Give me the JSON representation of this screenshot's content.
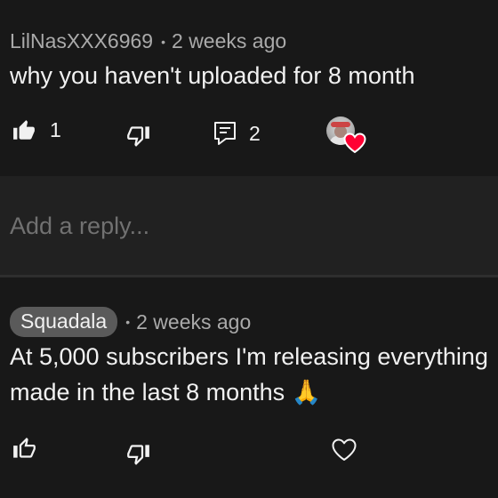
{
  "comment": {
    "author": "LilNasXXX6969",
    "separator": "•",
    "time": "2 weeks ago",
    "text": "why you haven't uploaded for 8 month",
    "like_count": "1",
    "reply_count": "2"
  },
  "reply_box": {
    "placeholder": "Add a reply..."
  },
  "reply": {
    "author": "Squadala",
    "separator": "•",
    "time": "2 weeks ago",
    "text_line1": "At 5,000 subscribers I'm releasing everything",
    "text_line2": "made in the last 8 months 🙏"
  },
  "colors": {
    "background": "#181818",
    "reply_box_background": "#212121",
    "author_pill": "#5a5a5a",
    "heart": "#ff0033"
  },
  "icons": {
    "like_filled": "thumbs-up-filled-icon",
    "dislike": "thumbs-down-icon",
    "replies": "comment-icon",
    "creator_heart": "heart-icon",
    "like_outline": "thumbs-up-icon",
    "heart_outline": "heart-outline-icon"
  }
}
